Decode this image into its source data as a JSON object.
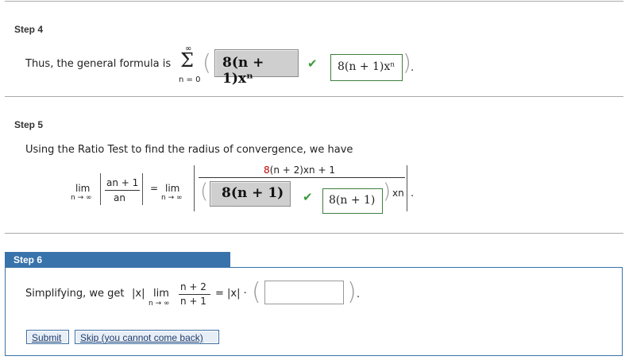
{
  "step4": {
    "label": "Step 4",
    "text": "Thus, the general formula is",
    "sigma": "Σ",
    "sum_upper": "∞",
    "sum_lower": "n = 0",
    "answer_gray": "8(n + 1)xⁿ",
    "answer_box": "8(n + 1)xⁿ",
    "check": "✔"
  },
  "step5": {
    "label": "Step 5",
    "text": "Using the Ratio Test to find the radius of convergence, we have",
    "lim": "lim",
    "lim_sub": "n → ∞",
    "a_num": "an + 1",
    "a_den": "an",
    "equals": "=",
    "numerator_coef": "8",
    "numerator_rest": "(n + 2)xn + 1",
    "answer_gray": "8(n + 1)",
    "answer_box": "8(n + 1)",
    "den_tail": "xn",
    "check": "✔"
  },
  "step6": {
    "label": "Step 6",
    "text": "Simplifying, we get",
    "absx": "|x|",
    "lim": "lim",
    "lim_sub": "n → ∞",
    "frac_num": "n + 2",
    "frac_den": "n + 1",
    "equals": "= |x| ·",
    "input_value": "",
    "submit_label": "Submit",
    "skip_label": "Skip (you cannot come back)"
  }
}
